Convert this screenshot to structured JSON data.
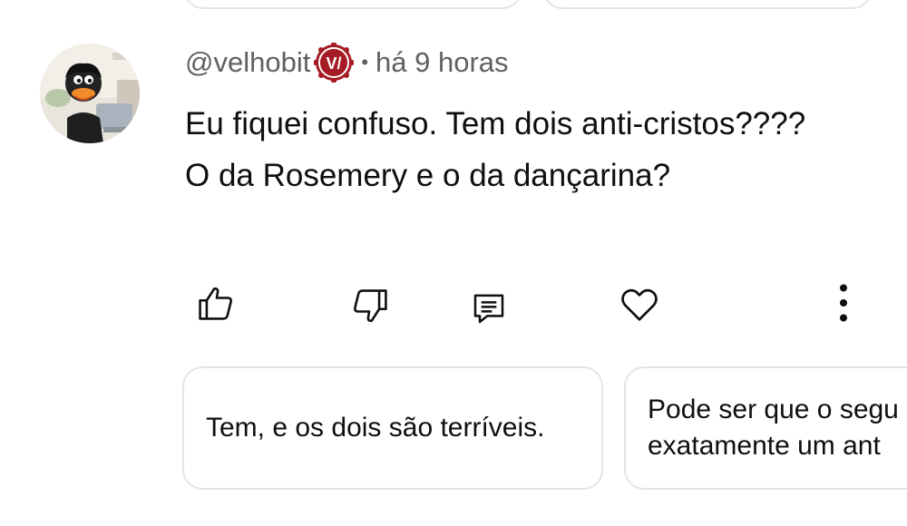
{
  "comment": {
    "author": "@velhobit",
    "badge_text": "V/",
    "separator": "•",
    "timestamp": "há 9 horas",
    "text": "Eu fiquei confuso. Tem dois anti-cristos???? O da Rosemery e o da dançarina?",
    "avatar_icon": "muppet-avatar-icon"
  },
  "actions": {
    "like": "thumbs-up-icon",
    "dislike": "thumbs-down-icon",
    "reply": "reply-icon",
    "heart": "heart-icon",
    "more": "more-vertical-icon"
  },
  "suggested_replies": [
    {
      "line1": "Tem, e os dois são terríveis."
    },
    {
      "line1": "Pode ser que o segu",
      "line2": "exatamente um ant"
    }
  ],
  "colors": {
    "badge_bg": "#a51c24",
    "meta_text": "#606060",
    "chip_border": "#e5e5e5",
    "text": "#0f0f0f"
  }
}
